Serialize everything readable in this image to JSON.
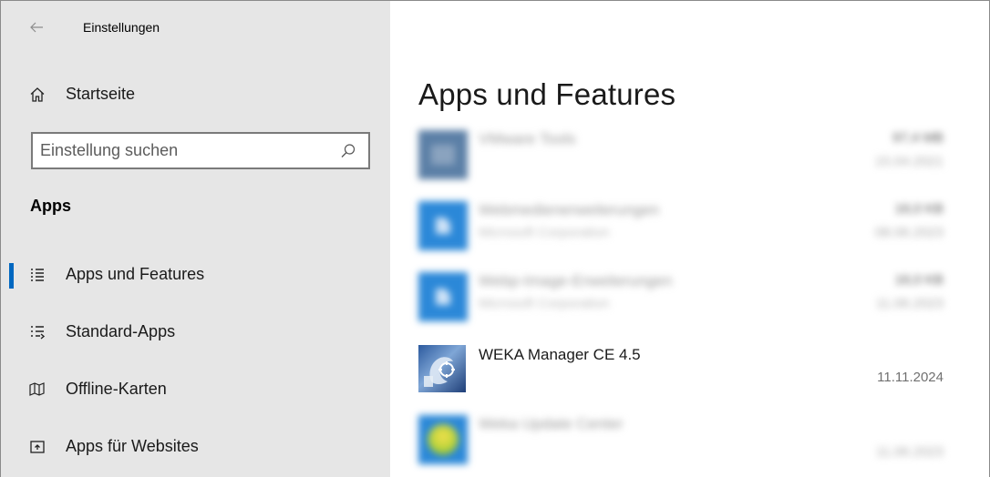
{
  "window": {
    "title": "Einstellungen",
    "back_icon": "arrow-left-icon"
  },
  "sidebar": {
    "home": {
      "label": "Startseite",
      "icon": "home-icon"
    },
    "search": {
      "placeholder": "Einstellung suchen",
      "value": "",
      "icon": "search-icon"
    },
    "section_title": "Apps",
    "items": [
      {
        "label": "Apps und Features",
        "icon": "apps-features-icon",
        "active": true
      },
      {
        "label": "Standard-Apps",
        "icon": "default-apps-icon",
        "active": false
      },
      {
        "label": "Offline-Karten",
        "icon": "offline-maps-icon",
        "active": false
      },
      {
        "label": "Apps für Websites",
        "icon": "apps-websites-icon",
        "active": false
      }
    ],
    "accent_color": "#0067c0"
  },
  "main": {
    "title": "Apps und Features",
    "apps": [
      {
        "name": "VMware Tools",
        "publisher": "",
        "size": "97,4 MB",
        "date": "15.04.2021",
        "blurred": true,
        "icon": "vmware-icon"
      },
      {
        "name": "Webmedienerweiterungen",
        "publisher": "Microsoft Corporation",
        "size": "16,0 KB",
        "date": "08.06.2023",
        "blurred": true,
        "icon": "store-app-icon"
      },
      {
        "name": "Webp-Image-Erweiterungen",
        "publisher": "Microsoft Corporation",
        "size": "16,0 KB",
        "date": "11.06.2023",
        "blurred": true,
        "icon": "store-app-icon"
      },
      {
        "name": "WEKA Manager CE 4.5",
        "publisher": "",
        "size": "",
        "date": "11.11.2024",
        "blurred": false,
        "icon": "weka-manager-icon"
      },
      {
        "name": "Weka Update Center",
        "publisher": "",
        "size": "",
        "date": "11.06.2023",
        "blurred": true,
        "icon": "weka-update-icon"
      }
    ]
  }
}
